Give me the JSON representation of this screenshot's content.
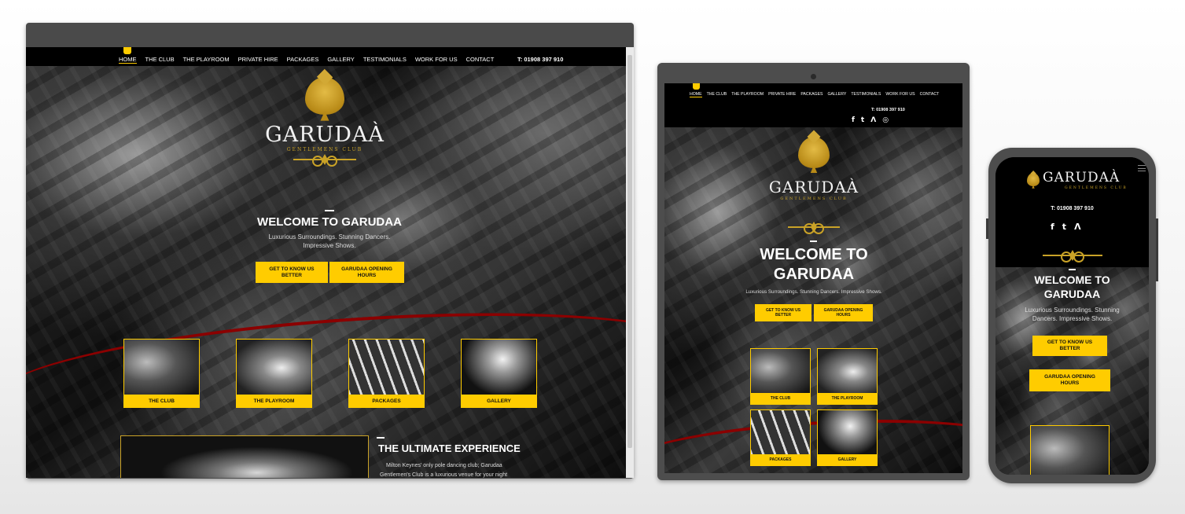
{
  "site": {
    "nav": [
      "HOME",
      "THE CLUB",
      "THE PLAYROOM",
      "PRIVATE HIRE",
      "PACKAGES",
      "GALLERY",
      "TESTIMONIALS",
      "WORK FOR US",
      "CONTACT"
    ],
    "active_nav": "HOME",
    "phone": "T: 01908 397 910",
    "logo_wordmark": "GARUDAÀ",
    "logo_tagline": "GENTLEMENS CLUB",
    "welcome": "WELCOME TO GARUDAA",
    "welcome_line1": "WELCOME TO",
    "welcome_line2": "GARUDAA",
    "subtext": "Luxurious Surroundings. Stunning Dancers. Impressive Shows.",
    "subtext_d1": "Luxurious Surroundings. Stunning Dancers.",
    "subtext_d2": "Impressive Shows.",
    "subtext_p1": "Luxurious Surroundings. Stunning",
    "subtext_p2": "Dancers. Impressive Shows.",
    "btn_know": "GET TO KNOW US BETTER",
    "btn_know_1": "GET TO KNOW US",
    "btn_know_2": "BETTER",
    "btn_hours": "GARUDAA OPENING HOURS",
    "btn_hours_1": "GARUDAA OPENING",
    "btn_hours_2": "HOURS",
    "tiles": [
      "THE CLUB",
      "THE PLAYROOM",
      "PACKAGES",
      "GALLERY"
    ],
    "experience_title": "THE ULTIMATE EXPERIENCE",
    "experience_line1": "Milton Keynes' only pole dancing club; Garudaa",
    "experience_line2": "Gentlemen's Club is a luxurious venue for your night",
    "social_icons": [
      "facebook-icon",
      "twitter-icon",
      "tripadvisor-icon",
      "instagram-icon"
    ],
    "social_glyphs": [
      "f",
      "t",
      "Ʌ",
      "◎"
    ]
  },
  "colors": {
    "accent_yellow": "#ffcc00",
    "gold": "#c9a227",
    "swoosh_red": "#8b0000",
    "frame": "#4a4a4a"
  }
}
